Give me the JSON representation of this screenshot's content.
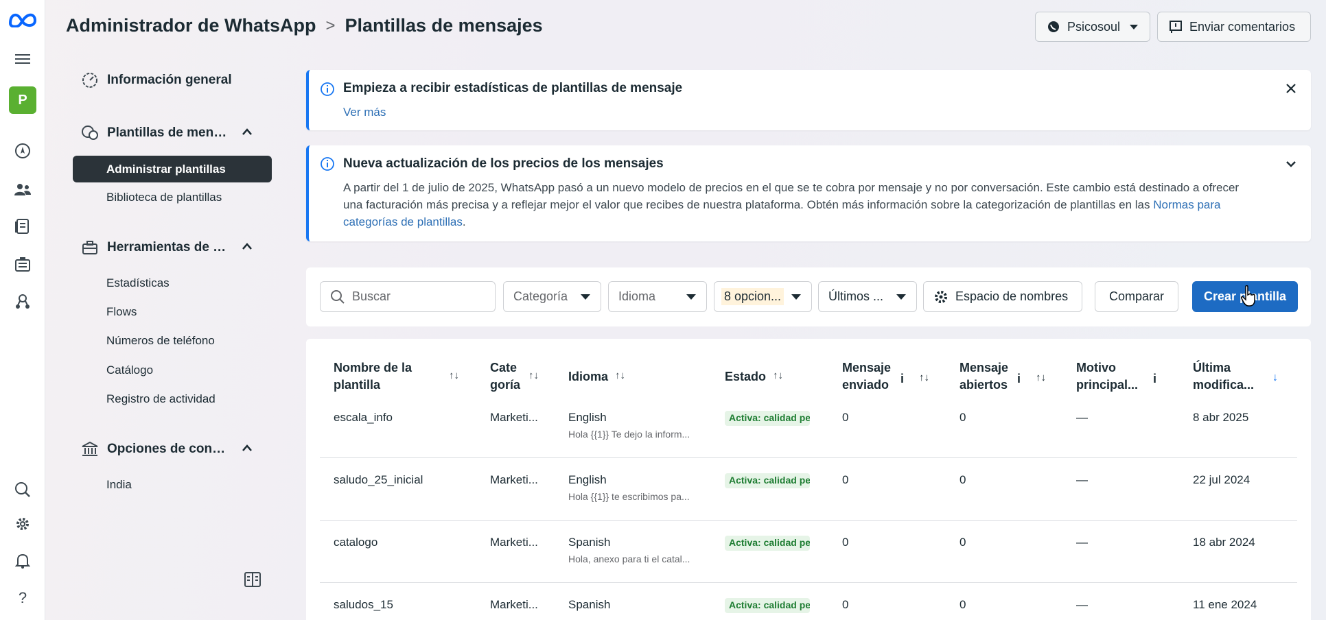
{
  "header": {
    "app_title": "Administrador de WhatsApp",
    "separator": ">",
    "page_title": "Plantillas de mensajes",
    "account_button": "Psicosoul",
    "feedback_button": "Enviar comentarios"
  },
  "rail": {
    "avatar_letter": "P",
    "help_label": "?"
  },
  "sidebar": {
    "overview": "Información general",
    "templates_section": "Plantillas de men…",
    "templates_items": [
      "Administrar plantillas",
      "Biblioteca de plantillas"
    ],
    "tools_section": "Herramientas de …",
    "tools_items": [
      "Estadísticas",
      "Flows",
      "Números de teléfono",
      "Catálogo",
      "Registro de actividad"
    ],
    "options_section": "Opciones de con…",
    "options_items": [
      "India"
    ]
  },
  "banner_stats": {
    "title": "Empieza a recibir estadísticas de plantillas de mensaje",
    "link": "Ver más"
  },
  "banner_pricing": {
    "title": "Nueva actualización de los precios de los mensajes",
    "body": "A partir del 1 de julio de 2025, WhatsApp pasó a un nuevo modelo de precios en el que se te cobra por mensaje y no por conversación. Este cambio está destinado a ofrecer una facturación más precisa y a reflejar mejor el valor que recibes de nuestra plataforma. Obtén más información sobre la categorización de plantillas en las ",
    "link": "Normas para categorías de plantillas",
    "end": "."
  },
  "toolbar": {
    "search_placeholder": "Buscar",
    "category": "Categoría",
    "language": "Idioma",
    "options": "8 opcion...",
    "date": "Últimos ...",
    "namespace": "Espacio de nombres",
    "compare": "Comparar",
    "create": "Crear plantilla"
  },
  "table": {
    "headers": {
      "name": [
        "Nombre de la",
        "plantilla"
      ],
      "category": [
        "Cate",
        "goría"
      ],
      "language": "Idioma",
      "status": "Estado",
      "sent": [
        "Mensaje",
        "enviado"
      ],
      "opened": [
        "Mensaje",
        "abiertos"
      ],
      "reason": [
        "Motivo",
        "principal..."
      ],
      "modified": [
        "Última",
        "modifica..."
      ]
    },
    "rows": [
      {
        "name": "escala_info",
        "category": "Marketi...",
        "language": "English",
        "preview": "Hola {{1}} Te dejo la inform...",
        "status": "Activa: calidad pendiente",
        "sent": "0",
        "opened": "0",
        "reason": "—",
        "modified": "8 abr 2025"
      },
      {
        "name": "saludo_25_inicial",
        "category": "Marketi...",
        "language": "English",
        "preview": "Hola {{1}} te escribimos pa...",
        "status": "Activa: calidad pendiente",
        "sent": "0",
        "opened": "0",
        "reason": "—",
        "modified": "22 jul 2024"
      },
      {
        "name": "catalogo",
        "category": "Marketi...",
        "language": "Spanish",
        "preview": "Hola, anexo para ti el catal...",
        "status": "Activa: calidad pendiente",
        "sent": "0",
        "opened": "0",
        "reason": "—",
        "modified": "18 abr 2024"
      },
      {
        "name": "saludos_15",
        "category": "Marketi...",
        "language": "Spanish",
        "preview": "",
        "status": "Activa: calidad pendiente",
        "sent": "0",
        "opened": "0",
        "reason": "—",
        "modified": "11 ene 2024"
      }
    ]
  },
  "colors": {
    "primary": "#1d6bc3",
    "active_nav": "#2b3339",
    "badge_bg": "#e6f4e7",
    "badge_text": "#1e7d32",
    "avatar": "#5ab031"
  }
}
